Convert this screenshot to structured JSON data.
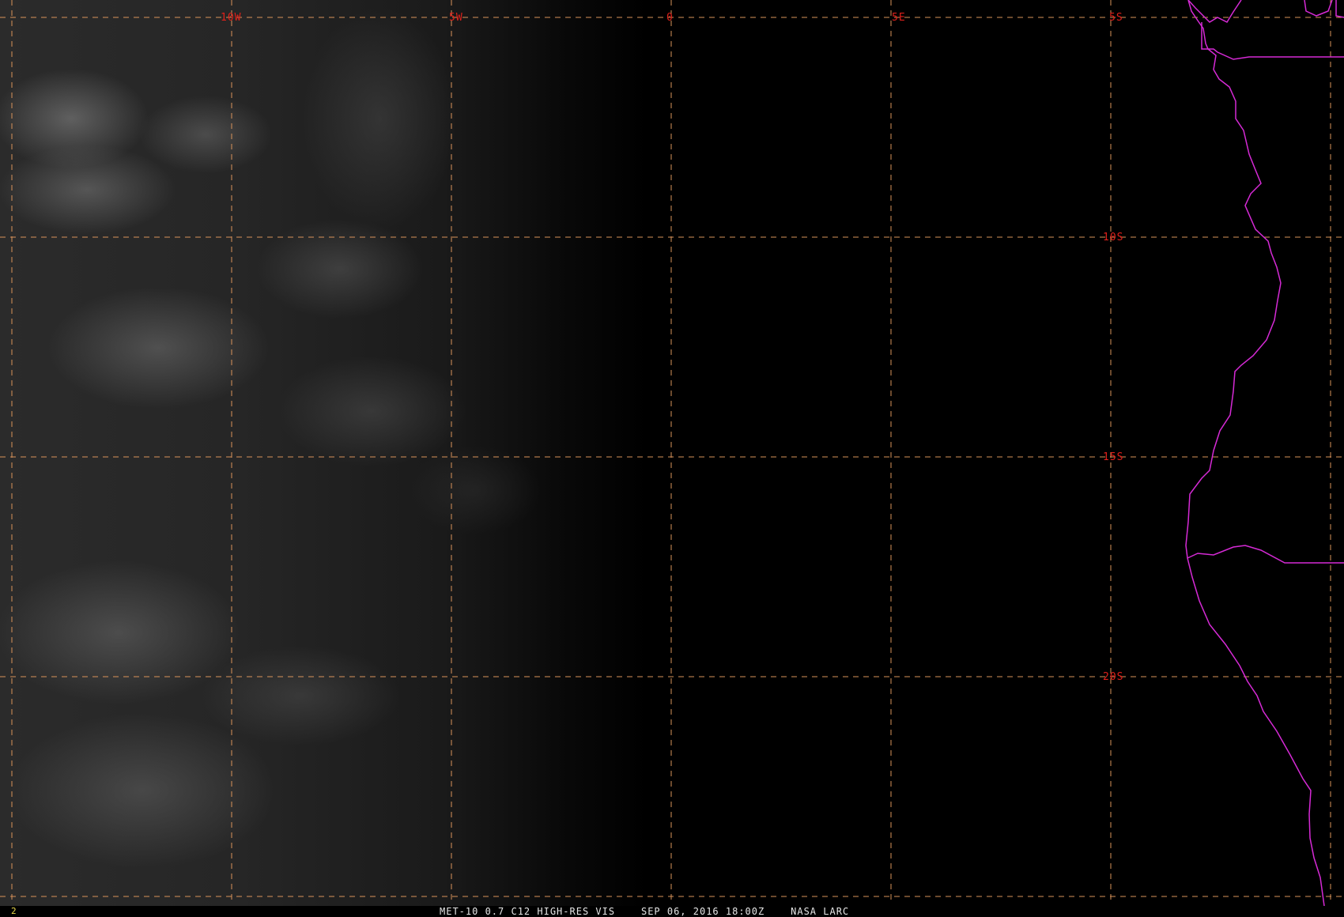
{
  "map": {
    "longitude_labels": [
      "10W",
      "5W",
      "0",
      "5E"
    ],
    "latitude_labels": [
      "5S",
      "10S",
      "15S",
      "20S"
    ],
    "grid_color": "#d9935a",
    "label_color": "#e0201a",
    "coastline_color": "#d62ad6"
  },
  "status": {
    "frame_number": "2",
    "caption": "MET-10 0.7 C12 HIGH-RES VIS    SEP 06, 2016 18:00Z    NASA LARC"
  }
}
